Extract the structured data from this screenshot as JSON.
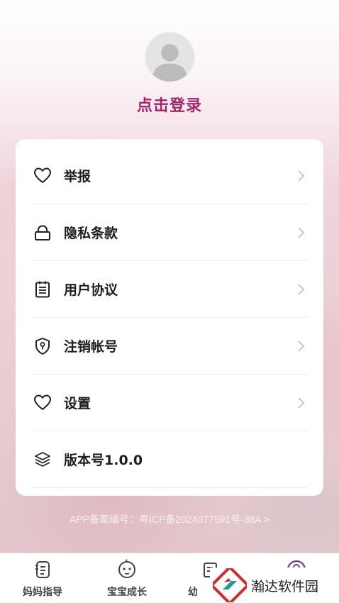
{
  "profile": {
    "login_label": "点击登录",
    "avatar_icon": "user-avatar-icon"
  },
  "menu": {
    "items": [
      {
        "label": "举报",
        "icon": "heart-icon",
        "chevron": true
      },
      {
        "label": "隐私条款",
        "icon": "lock-icon",
        "chevron": true
      },
      {
        "label": "用户协议",
        "icon": "clipboard-icon",
        "chevron": true
      },
      {
        "label": "注销帐号",
        "icon": "shield-icon",
        "chevron": true
      },
      {
        "label": "设置",
        "icon": "heart-icon",
        "chevron": true
      },
      {
        "label": "版本号1.0.0",
        "icon": "layers-icon",
        "chevron": false
      }
    ]
  },
  "footer": {
    "beian": "APP备案编号：粤ICP备2024077591号-38A >"
  },
  "tabbar": {
    "tabs": [
      {
        "label": "妈妈指导",
        "icon": "document-icon"
      },
      {
        "label": "宝宝成长",
        "icon": "baby-face-icon"
      },
      {
        "label": "幼",
        "icon": "edit-icon"
      },
      {
        "label": "",
        "icon": "profile-icon"
      }
    ]
  },
  "watermark": {
    "text": "瀚达软件园"
  },
  "colors": {
    "accent": "#a8226a",
    "text": "#1e1e1e",
    "profile_tab": "#6a3d9a"
  }
}
